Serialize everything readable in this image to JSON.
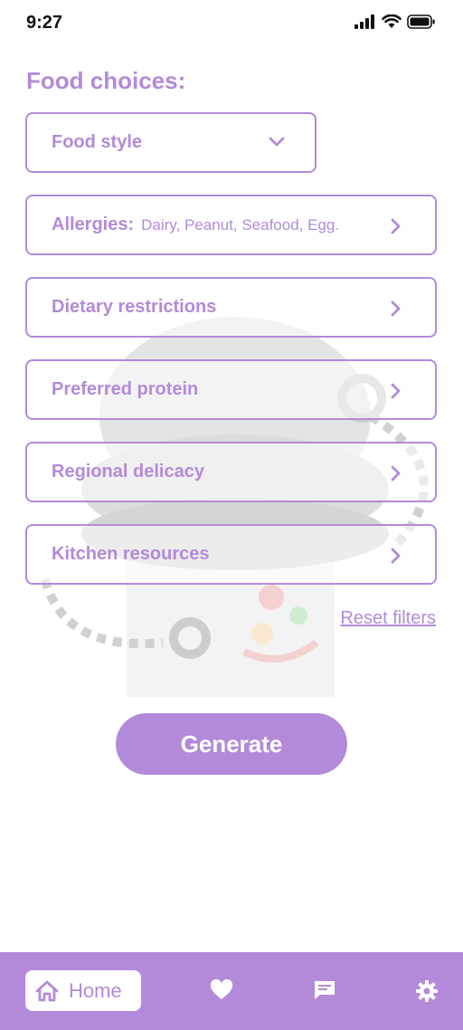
{
  "status_bar": {
    "time": "9:27"
  },
  "colors": {
    "accent": "#b38ad9",
    "background": "#ffffff",
    "text_dark": "#111111"
  },
  "page": {
    "section_title": "Food choices:"
  },
  "food_style": {
    "label": "Food style",
    "icon": "chevron-down-icon"
  },
  "rows": [
    {
      "label": "Allergies:",
      "value": "Dairy, Peanut, Seafood, Egg.",
      "icon": "chevron-right-icon"
    },
    {
      "label": "Dietary restrictions",
      "value": "",
      "icon": "chevron-right-icon"
    },
    {
      "label": "Preferred protein",
      "value": "",
      "icon": "chevron-right-icon"
    },
    {
      "label": "Regional delicacy",
      "value": "",
      "icon": "chevron-right-icon"
    },
    {
      "label": "Kitchen resources",
      "value": "",
      "icon": "chevron-right-icon"
    }
  ],
  "reset_link": "Reset filters",
  "generate_button": "Generate",
  "bottom_nav": {
    "home_label": "Home",
    "icons": [
      "home-icon",
      "heart-icon",
      "chat-icon",
      "gear-icon"
    ]
  }
}
